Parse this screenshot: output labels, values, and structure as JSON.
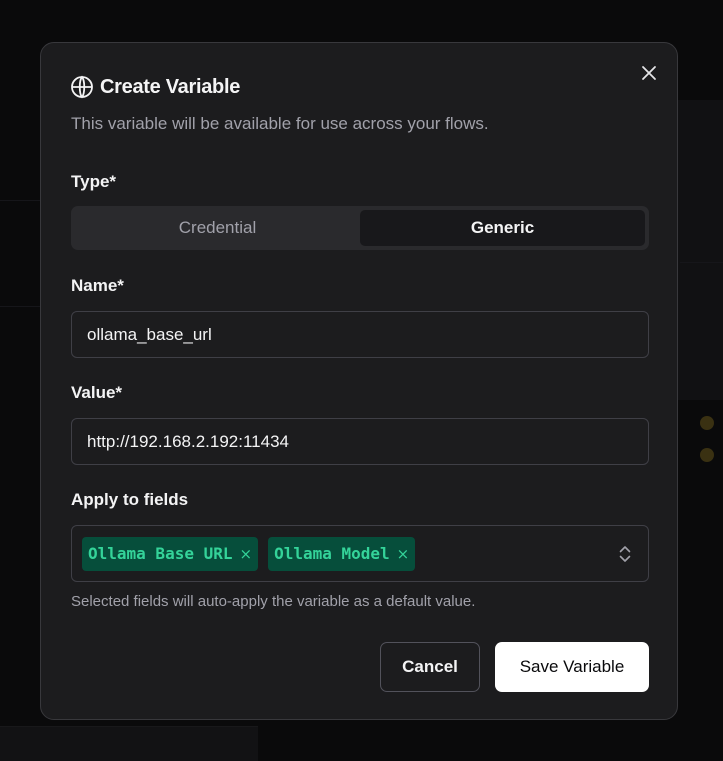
{
  "dialog": {
    "title": "Create Variable",
    "subtitle": "This variable will be available for use across your flows.",
    "icon": "globe-icon",
    "close_icon": "close-icon"
  },
  "type_field": {
    "label": "Type*",
    "options": [
      "Credential",
      "Generic"
    ],
    "selected": "Generic"
  },
  "name_field": {
    "label": "Name*",
    "value": "ollama_base_url"
  },
  "value_field": {
    "label": "Value*",
    "value": "http://192.168.2.192:11434"
  },
  "apply_field": {
    "label": "Apply to fields",
    "chips": [
      "Ollama Base URL",
      "Ollama Model"
    ],
    "chip_remove_glyph": "×",
    "helper": "Selected fields will auto-apply the variable as a default value."
  },
  "actions": {
    "cancel_label": "Cancel",
    "save_label": "Save Variable"
  },
  "colors": {
    "modal_bg": "#1c1c1e",
    "chip_bg": "#064e3b",
    "chip_text": "#34d399",
    "primary_button_bg": "#ffffff"
  }
}
